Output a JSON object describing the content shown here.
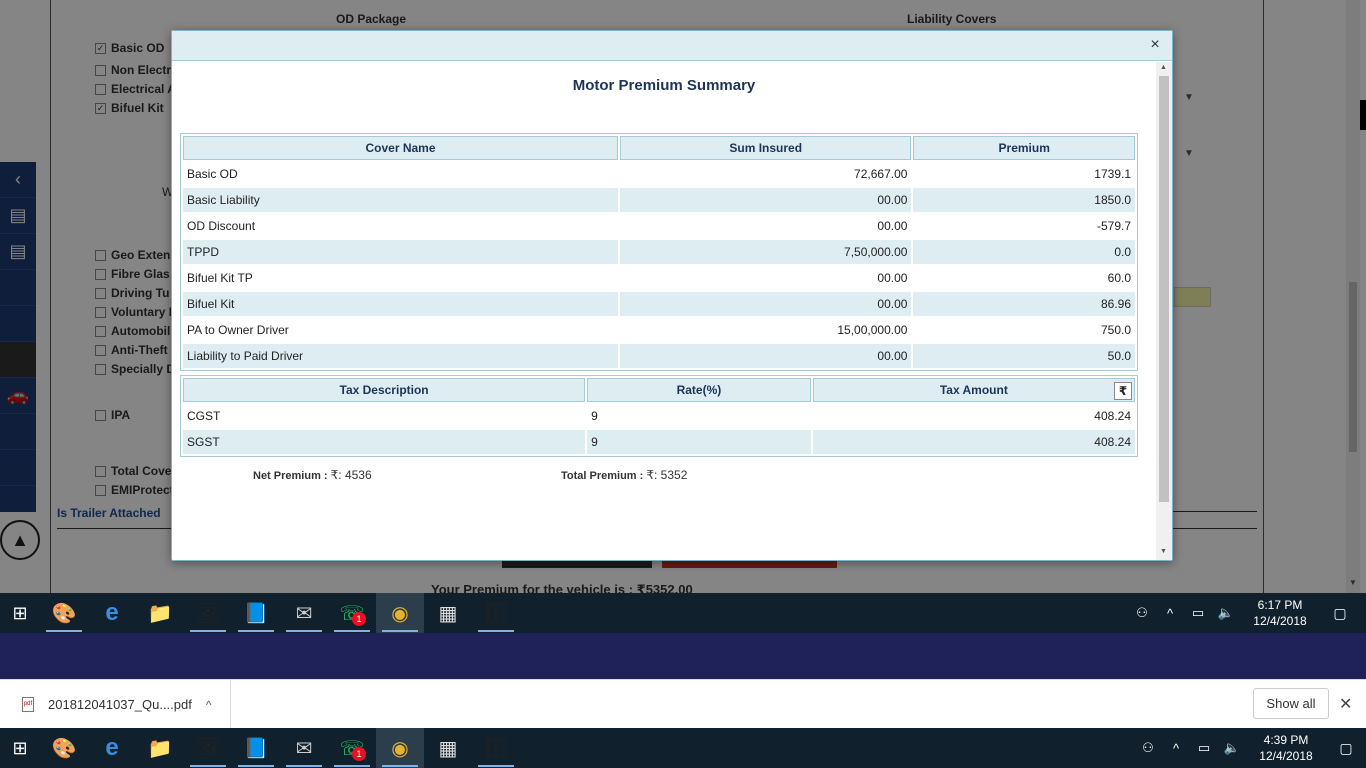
{
  "background": {
    "od_heading": "OD Package",
    "liability_heading": "Liability Covers",
    "options": [
      {
        "label": "Basic OD",
        "checked": true
      },
      {
        "label": "Non Electr",
        "checked": false
      },
      {
        "label": "Electrical A",
        "checked": false
      },
      {
        "label": "Bifuel Kit",
        "checked": true
      },
      {
        "label": "Geo Exten",
        "checked": false
      },
      {
        "label": "Fibre Glas",
        "checked": false
      },
      {
        "label": "Driving Tu",
        "checked": false
      },
      {
        "label": "Voluntary I",
        "checked": false
      },
      {
        "label": "Automobil",
        "checked": false
      },
      {
        "label": "Anti-Theft",
        "checked": false
      },
      {
        "label": "Specially D",
        "checked": false
      },
      {
        "label": "IPA",
        "checked": false
      },
      {
        "label": "Total Cove",
        "checked": false
      },
      {
        "label": "EMIProtect",
        "checked": false
      }
    ],
    "w_fragment": "W",
    "trailer_label": "Is Trailer Attached",
    "premium_text": "Your Premium for the vehicle is : ₹5352.00"
  },
  "modal": {
    "close_symbol": "×",
    "title": "Motor Premium Summary",
    "cover_table": {
      "headers": [
        "Cover Name",
        "Sum Insured",
        "Premium"
      ],
      "rows": [
        [
          "Basic OD",
          "72,667.00",
          "1739.1"
        ],
        [
          "Basic Liability",
          "00.00",
          "1850.0"
        ],
        [
          "OD Discount",
          "00.00",
          "-579.7"
        ],
        [
          "TPPD",
          "7,50,000.00",
          "0.0"
        ],
        [
          "Bifuel Kit TP",
          "00.00",
          "60.0"
        ],
        [
          "Bifuel Kit",
          "00.00",
          "86.96"
        ],
        [
          "PA to Owner Driver",
          "15,00,000.00",
          "750.0"
        ],
        [
          "Liability to Paid Driver",
          "00.00",
          "50.0"
        ]
      ]
    },
    "tax_table": {
      "headers": [
        "Tax Description",
        "Rate(%)",
        "Tax Amount"
      ],
      "currency_symbol": "₹",
      "rows": [
        [
          "CGST",
          "9",
          "408.24"
        ],
        [
          "SGST",
          "9",
          "408.24"
        ]
      ]
    },
    "net_premium_label": "Net Premium :",
    "net_premium_value": "₹: 4536",
    "total_premium_label": "Total Premium :",
    "total_premium_value": "₹: 5352"
  },
  "taskbar_inner": {
    "apps": [
      {
        "name": "paint-icon",
        "glyph": "🎨",
        "badge": ""
      },
      {
        "name": "edge-icon",
        "glyph": "e",
        "badge": ""
      },
      {
        "name": "file-explorer-icon",
        "glyph": "📁",
        "badge": ""
      },
      {
        "name": "photos-icon",
        "glyph": "🖼",
        "badge": ""
      },
      {
        "name": "notes-icon",
        "glyph": "📘",
        "badge": ""
      },
      {
        "name": "mail-icon",
        "glyph": "✉",
        "badge": ""
      },
      {
        "name": "whatsapp-icon",
        "glyph": "☏",
        "badge": "1"
      },
      {
        "name": "chrome-icon",
        "glyph": "◉",
        "badge": ""
      },
      {
        "name": "calculator-icon",
        "glyph": "▦",
        "badge": ""
      },
      {
        "name": "archive-icon",
        "glyph": "🗄",
        "badge": ""
      }
    ],
    "time": "6:17 PM",
    "date": "12/4/2018"
  },
  "download_bar": {
    "file_name": "201812041037_Qu....pdf",
    "file_type": "pdf",
    "show_all_label": "Show all",
    "close_symbol": "✕"
  },
  "taskbar_outer": {
    "time": "4:39 PM",
    "date": "12/4/2018"
  },
  "colors": {
    "modal_header": "#deedf2",
    "table_border": "#a6cbd8",
    "title_text": "#1c3557",
    "taskbar": "#10202c",
    "navy_band": "#1f2159"
  }
}
